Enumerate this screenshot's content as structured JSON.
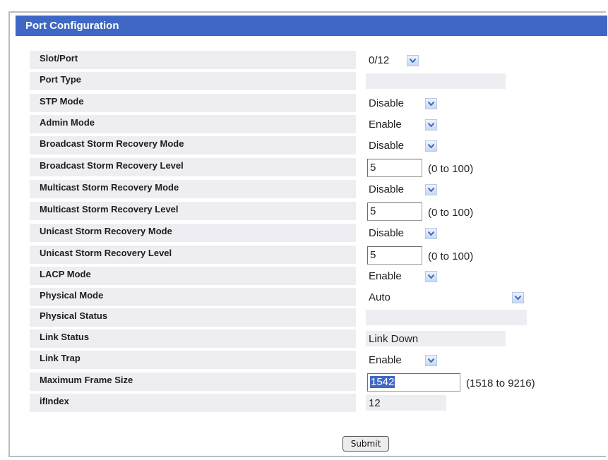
{
  "panel": {
    "title": "Port Configuration"
  },
  "fields": {
    "slot_port": {
      "label": "Slot/Port",
      "value": "0/12"
    },
    "port_type": {
      "label": "Port Type",
      "value": ""
    },
    "stp_mode": {
      "label": "STP Mode",
      "value": "Disable"
    },
    "admin_mode": {
      "label": "Admin Mode",
      "value": "Enable"
    },
    "bcast_mode": {
      "label": "Broadcast Storm Recovery Mode",
      "value": "Disable"
    },
    "bcast_level": {
      "label": "Broadcast Storm Recovery Level",
      "value": "5",
      "range": "(0 to 100)"
    },
    "mcast_mode": {
      "label": "Multicast Storm Recovery Mode",
      "value": "Disable"
    },
    "mcast_level": {
      "label": "Multicast Storm Recovery Level",
      "value": "5",
      "range": "(0 to 100)"
    },
    "ucast_mode": {
      "label": "Unicast Storm Recovery Mode",
      "value": "Disable"
    },
    "ucast_level": {
      "label": "Unicast Storm Recovery Level",
      "value": "5",
      "range": "(0 to 100)"
    },
    "lacp_mode": {
      "label": "LACP Mode",
      "value": "Enable"
    },
    "physical_mode": {
      "label": "Physical Mode",
      "value": "Auto"
    },
    "physical_status": {
      "label": "Physical Status",
      "value": ""
    },
    "link_status": {
      "label": "Link Status",
      "value": "Link Down"
    },
    "link_trap": {
      "label": "Link Trap",
      "value": "Enable"
    },
    "max_frame": {
      "label": "Maximum Frame Size",
      "value": "1542",
      "range": "(1518 to 9216)"
    },
    "ifindex": {
      "label": "ifIndex",
      "value": "12"
    }
  },
  "actions": {
    "submit_label": "Submit"
  },
  "icons": {
    "dropdown": "chevron-down-icon"
  },
  "colors": {
    "header": "#3f67c5",
    "label_bg": "#ededf2",
    "dropdown_button": "#c8d8f0"
  }
}
